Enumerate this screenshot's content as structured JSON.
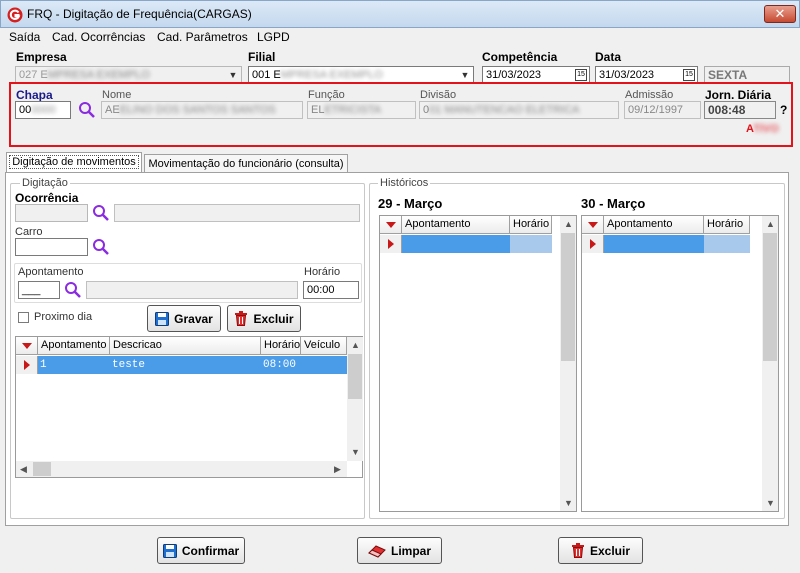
{
  "window": {
    "title": "FRQ - Digitação de Frequência(CARGAS)",
    "close_label": "✕"
  },
  "menu": [
    "Saída",
    "Cad. Ocorrências",
    "Cad. Parâmetros",
    "LGPD"
  ],
  "header": {
    "empresa_label": "Empresa",
    "empresa_value": "027 E",
    "filial_label": "Filial",
    "filial_value": "001 E",
    "competencia_label": "Competência",
    "competencia_value": "31/03/2023",
    "data_label": "Data",
    "data_value": "31/03/2023",
    "weekday": "SEXTA"
  },
  "employee": {
    "chapa_label": "Chapa",
    "chapa_value": "00",
    "nome_label": "Nome",
    "nome_value": "AE",
    "funcao_label": "Função",
    "funcao_value": "EL",
    "divisao_label": "Divisão",
    "divisao_value": "0",
    "admissao_label": "Admissão",
    "admissao_value": "09/12/1997",
    "jornada_label": "Jorn. Diária",
    "jornada_value": "008:48",
    "status_value": "A",
    "help_label": "?"
  },
  "tabs": [
    "Digitação de movimentos",
    "Movimentação do funcionário (consulta)"
  ],
  "digitacao": {
    "group_title": "Digitação",
    "ocorrencia_label": "Ocorrência",
    "carro_label": "Carro",
    "apontamento_label": "Apontamento",
    "apontamento_value": "___",
    "horario_label": "Horário",
    "horario_value": "00:00",
    "proximo_dia_label": "Proximo dia",
    "gravar_label": "Gravar",
    "excluir_label": "Excluir",
    "grid_headers": [
      "Apontamento",
      "Descricao",
      "Horário",
      "Veículo"
    ],
    "rows": [
      {
        "apontamento": "1",
        "descricao": "teste",
        "horario": "08:00",
        "veiculo": ""
      }
    ]
  },
  "historicos": {
    "group_title": "Históricos",
    "day1_title": "29 - Março",
    "day2_title": "30 - Março",
    "headers": [
      "Apontamento",
      "Horário"
    ]
  },
  "footer": {
    "confirmar_label": "Confirmar",
    "limpar_label": "Limpar",
    "excluir_label": "Excluir"
  },
  "colors": {
    "highlight": "#e4121b",
    "selection": "#4a9be8",
    "search_icon": "#8a2be2"
  }
}
